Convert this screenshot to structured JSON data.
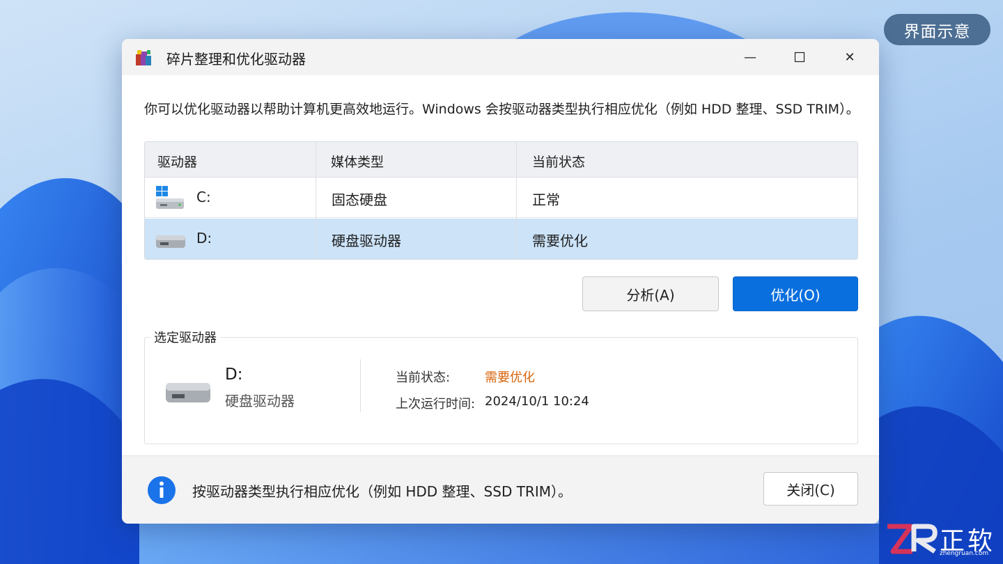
{
  "badge": {
    "label": "界面示意"
  },
  "window": {
    "title": "碎片整理和优化驱动器",
    "controls": {
      "minimize": "—",
      "close": "✕"
    }
  },
  "description": "你可以优化驱动器以帮助计算机更高效地运行。Windows 会按驱动器类型执行相应优化（例如 HDD 整理、SSD TRIM）。",
  "table": {
    "headers": [
      "驱动器",
      "媒体类型",
      "当前状态"
    ],
    "rows": [
      {
        "drive": "C:",
        "media": "固态硬盘",
        "status": "正常",
        "icon": "windows-drive-icon"
      },
      {
        "drive": "D:",
        "media": "硬盘驱动器",
        "status": "需要优化",
        "icon": "hard-drive-icon",
        "selected": true
      }
    ]
  },
  "buttons": {
    "analyze": "分析(A)",
    "optimize": "优化(O)",
    "close": "关闭(C)"
  },
  "selected": {
    "group_label": "选定驱动器",
    "name": "D:",
    "type": "硬盘驱动器",
    "status_label": "当前状态:",
    "status_value": "需要优化",
    "last_run_label": "上次运行时间:",
    "last_run_value": "2024/10/1 10:24"
  },
  "footer": {
    "text": "按驱动器类型执行相应优化（例如 HDD 整理、SSD TRIM）。"
  },
  "watermark": {
    "text": "正软",
    "sub": "zhengruan.com"
  },
  "colors": {
    "accent": "#0a6fde",
    "selected_row": "#cce3f8",
    "warning": "#d8650c",
    "info": "#1a73e8"
  }
}
